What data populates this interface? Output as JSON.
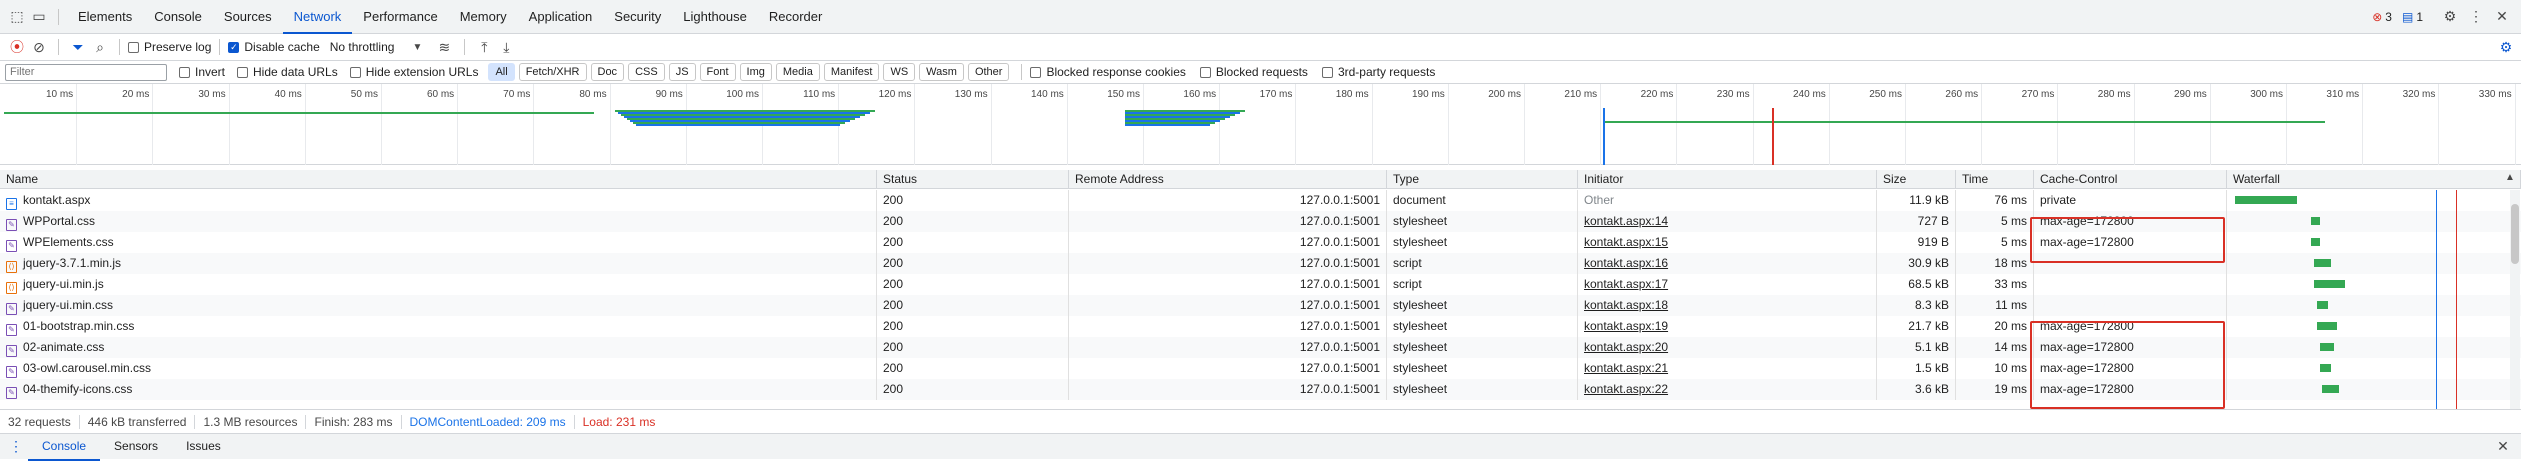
{
  "tabs": [
    "Elements",
    "Console",
    "Sources",
    "Network",
    "Performance",
    "Memory",
    "Application",
    "Security",
    "Lighthouse",
    "Recorder"
  ],
  "active_tab": "Network",
  "badges": {
    "errors": "3",
    "messages": "1"
  },
  "toolbar": {
    "preserve_log": "Preserve log",
    "disable_cache": "Disable cache",
    "throttling": "No throttling"
  },
  "filter": {
    "placeholder": "Filter",
    "invert": "Invert",
    "hide_data_urls": "Hide data URLs",
    "hide_extension_urls": "Hide extension URLs",
    "types": [
      "All",
      "Fetch/XHR",
      "Doc",
      "CSS",
      "JS",
      "Font",
      "Img",
      "Media",
      "Manifest",
      "WS",
      "Wasm",
      "Other"
    ],
    "blocked_cookies": "Blocked response cookies",
    "blocked_requests": "Blocked requests",
    "third_party": "3rd-party requests"
  },
  "overview": {
    "ticks": [
      "10 ms",
      "20 ms",
      "30 ms",
      "40 ms",
      "50 ms",
      "60 ms",
      "70 ms",
      "80 ms",
      "90 ms",
      "100 ms",
      "110 ms",
      "120 ms",
      "130 ms",
      "140 ms",
      "150 ms",
      "160 ms",
      "170 ms",
      "180 ms",
      "190 ms",
      "200 ms",
      "210 ms",
      "220 ms",
      "230 ms",
      "240 ms",
      "250 ms",
      "260 ms",
      "270 ms",
      "280 ms",
      "290 ms",
      "300 ms",
      "310 ms",
      "320 ms",
      "330 ms"
    ]
  },
  "columns": [
    "Name",
    "Status",
    "Remote Address",
    "Type",
    "Initiator",
    "Size",
    "Time",
    "Cache-Control",
    "Waterfall"
  ],
  "rows": [
    {
      "name": "kontakt.aspx",
      "kind": "doc",
      "status": "200",
      "remote": "127.0.0.1:5001",
      "type": "document",
      "initiator": "Other",
      "size": "11.9 kB",
      "time": "76 ms",
      "cache": "private",
      "wf_start": 0.0,
      "wf_dur": 0.22
    },
    {
      "name": "WPPortal.css",
      "kind": "css",
      "status": "200",
      "remote": "127.0.0.1:5001",
      "type": "stylesheet",
      "initiator": "kontakt.aspx:14",
      "size": "727 B",
      "time": "5 ms",
      "cache": "max-age=172800",
      "wf_start": 0.27,
      "wf_dur": 0.03
    },
    {
      "name": "WPElements.css",
      "kind": "css",
      "status": "200",
      "remote": "127.0.0.1:5001",
      "type": "stylesheet",
      "initiator": "kontakt.aspx:15",
      "size": "919 B",
      "time": "5 ms",
      "cache": "max-age=172800",
      "wf_start": 0.27,
      "wf_dur": 0.03
    },
    {
      "name": "jquery-3.7.1.min.js",
      "kind": "js",
      "status": "200",
      "remote": "127.0.0.1:5001",
      "type": "script",
      "initiator": "kontakt.aspx:16",
      "size": "30.9 kB",
      "time": "18 ms",
      "cache": "",
      "wf_start": 0.28,
      "wf_dur": 0.06
    },
    {
      "name": "jquery-ui.min.js",
      "kind": "js",
      "status": "200",
      "remote": "127.0.0.1:5001",
      "type": "script",
      "initiator": "kontakt.aspx:17",
      "size": "68.5 kB",
      "time": "33 ms",
      "cache": "",
      "wf_start": 0.28,
      "wf_dur": 0.11
    },
    {
      "name": "jquery-ui.min.css",
      "kind": "css",
      "status": "200",
      "remote": "127.0.0.1:5001",
      "type": "stylesheet",
      "initiator": "kontakt.aspx:18",
      "size": "8.3 kB",
      "time": "11 ms",
      "cache": "",
      "wf_start": 0.29,
      "wf_dur": 0.04
    },
    {
      "name": "01-bootstrap.min.css",
      "kind": "css",
      "status": "200",
      "remote": "127.0.0.1:5001",
      "type": "stylesheet",
      "initiator": "kontakt.aspx:19",
      "size": "21.7 kB",
      "time": "20 ms",
      "cache": "max-age=172800",
      "wf_start": 0.29,
      "wf_dur": 0.07
    },
    {
      "name": "02-animate.css",
      "kind": "css",
      "status": "200",
      "remote": "127.0.0.1:5001",
      "type": "stylesheet",
      "initiator": "kontakt.aspx:20",
      "size": "5.1 kB",
      "time": "14 ms",
      "cache": "max-age=172800",
      "wf_start": 0.3,
      "wf_dur": 0.05
    },
    {
      "name": "03-owl.carousel.min.css",
      "kind": "css",
      "status": "200",
      "remote": "127.0.0.1:5001",
      "type": "stylesheet",
      "initiator": "kontakt.aspx:21",
      "size": "1.5 kB",
      "time": "10 ms",
      "cache": "max-age=172800",
      "wf_start": 0.3,
      "wf_dur": 0.04
    },
    {
      "name": "04-themify-icons.css",
      "kind": "css",
      "status": "200",
      "remote": "127.0.0.1:5001",
      "type": "stylesheet",
      "initiator": "kontakt.aspx:22",
      "size": "3.6 kB",
      "time": "19 ms",
      "cache": "max-age=172800",
      "wf_start": 0.31,
      "wf_dur": 0.06
    }
  ],
  "status": {
    "requests": "32 requests",
    "transferred": "446 kB transferred",
    "resources": "1.3 MB resources",
    "finish": "Finish: 283 ms",
    "dcl": "DOMContentLoaded: 209 ms",
    "load": "Load: 231 ms"
  },
  "drawer_tabs": [
    "Console",
    "Sensors",
    "Issues"
  ],
  "colors": {
    "accent": "#0b57d0",
    "dcl": "#1a73e8",
    "load": "#d93025",
    "wf_green": "#34a853",
    "highlight": "#d93025"
  }
}
